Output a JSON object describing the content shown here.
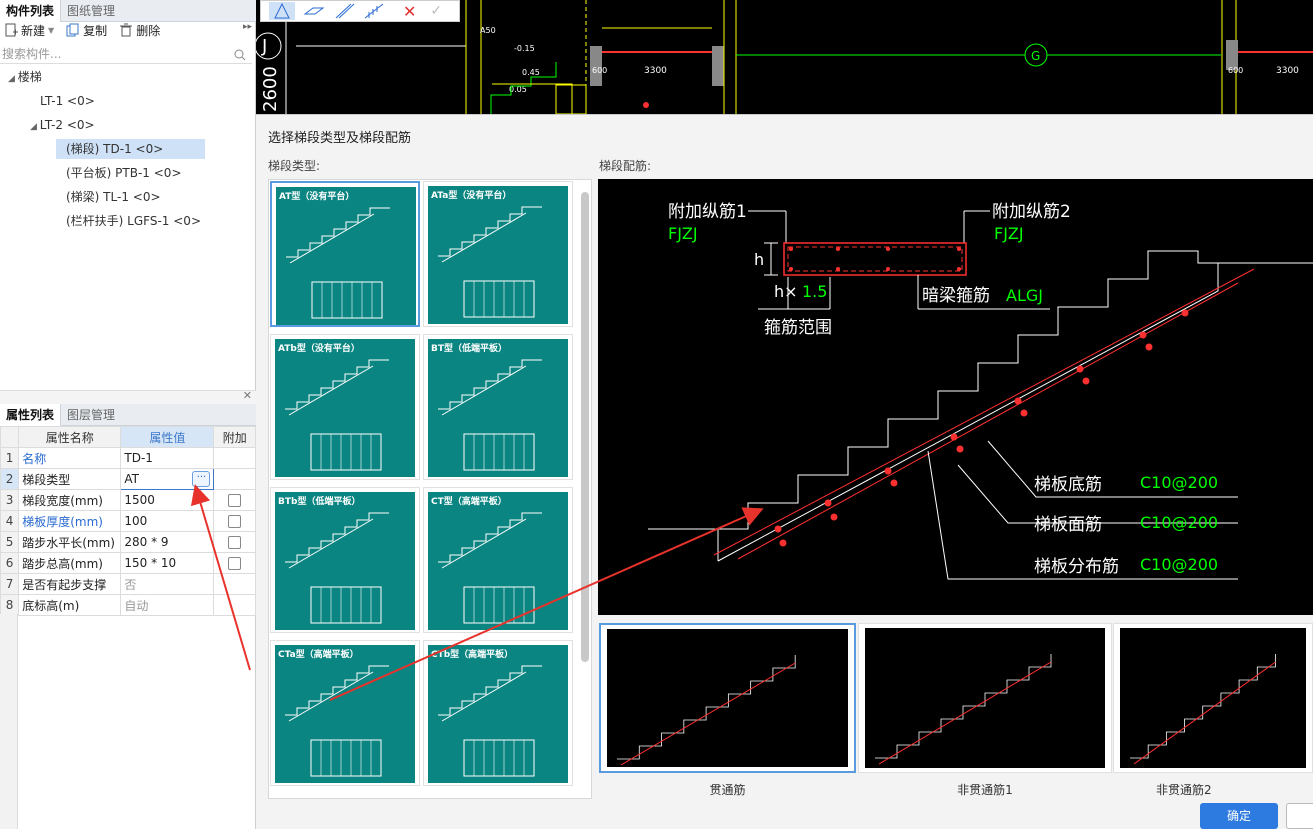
{
  "left_panel": {
    "tabs": [
      "构件列表",
      "图纸管理"
    ],
    "toolbar": {
      "new": "新建",
      "copy": "复制",
      "delete": "删除"
    },
    "search_placeholder": "搜索构件...",
    "tree": {
      "root": "楼梯",
      "lt1": "LT-1 <0>",
      "lt2": "LT-2 <0>",
      "td1": "(梯段) TD-1 <0>",
      "ptb1": "(平台板) PTB-1 <0>",
      "tl1": "(梯梁) TL-1 <0>",
      "lgfs1": "(栏杆扶手) LGFS-1 <0>"
    },
    "bottom_tabs": [
      "属性列表",
      "图层管理"
    ],
    "grid_headers": {
      "name": "属性名称",
      "value": "属性值",
      "extra": "附加"
    },
    "rows": [
      {
        "n": "1",
        "name": "名称",
        "value": "TD-1"
      },
      {
        "n": "2",
        "name": "梯段类型",
        "value": "AT"
      },
      {
        "n": "3",
        "name": "梯段宽度(mm)",
        "value": "1500"
      },
      {
        "n": "4",
        "name": "梯板厚度(mm)",
        "value": "100"
      },
      {
        "n": "5",
        "name": "踏步水平长(mm)",
        "value": "280 * 9"
      },
      {
        "n": "6",
        "name": "踏步总高(mm)",
        "value": "150 * 10"
      },
      {
        "n": "7",
        "name": "是否有起步支撑",
        "value": "否"
      },
      {
        "n": "8",
        "name": "底标高(m)",
        "value": "自动"
      }
    ]
  },
  "cad_top": {
    "grid_label_j": "J",
    "grid_label_g": "G",
    "dim_2600": "2600",
    "dim_a50": "A50",
    "dim_015": "-0.15",
    "dim_045": "0.45",
    "dim_005": "0.05",
    "dim_600a": "600",
    "dim_3300a": "3300",
    "dim_600b": "600",
    "dim_3300b": "3300"
  },
  "dialog": {
    "title": "选择梯段类型及梯段配筋",
    "type_label": "梯段类型:",
    "rebar_label": "梯段配筋:",
    "types": [
      "AT型（没有平台）",
      "ATa型（没有平台）",
      "ATb型（没有平台）",
      "BT型（低端平板）",
      "BTb型（低端平板）",
      "CT型（高端平板）",
      "CTa型（高端平板）",
      "CTb型（高端平板）"
    ],
    "preview": {
      "fjzj1": "附加纵筋1",
      "fjzj1_code": "FJZJ",
      "fjzj2": "附加纵筋2",
      "fjzj2_code": "FJZJ",
      "h": "h",
      "h_x": "h×",
      "h_factor": "1.5",
      "stirrup_range": "箍筋范围",
      "hidden_beam": "暗梁箍筋",
      "hidden_beam_code": "ALGJ",
      "bottom_bar": "梯板底筋",
      "bottom_bar_val": "C10@200",
      "top_bar": "梯板面筋",
      "top_bar_val": "C10@200",
      "dist_bar": "梯板分布筋",
      "dist_bar_val": "C10@200"
    },
    "rebar_options": [
      "贯通筋",
      "非贯通筋1",
      "非贯通筋2"
    ],
    "ok": "确定"
  },
  "colors": {
    "teal": "#0b8581",
    "accent": "#2d7be0",
    "cad_green": "#00ff00",
    "cad_red": "#ff2020"
  }
}
